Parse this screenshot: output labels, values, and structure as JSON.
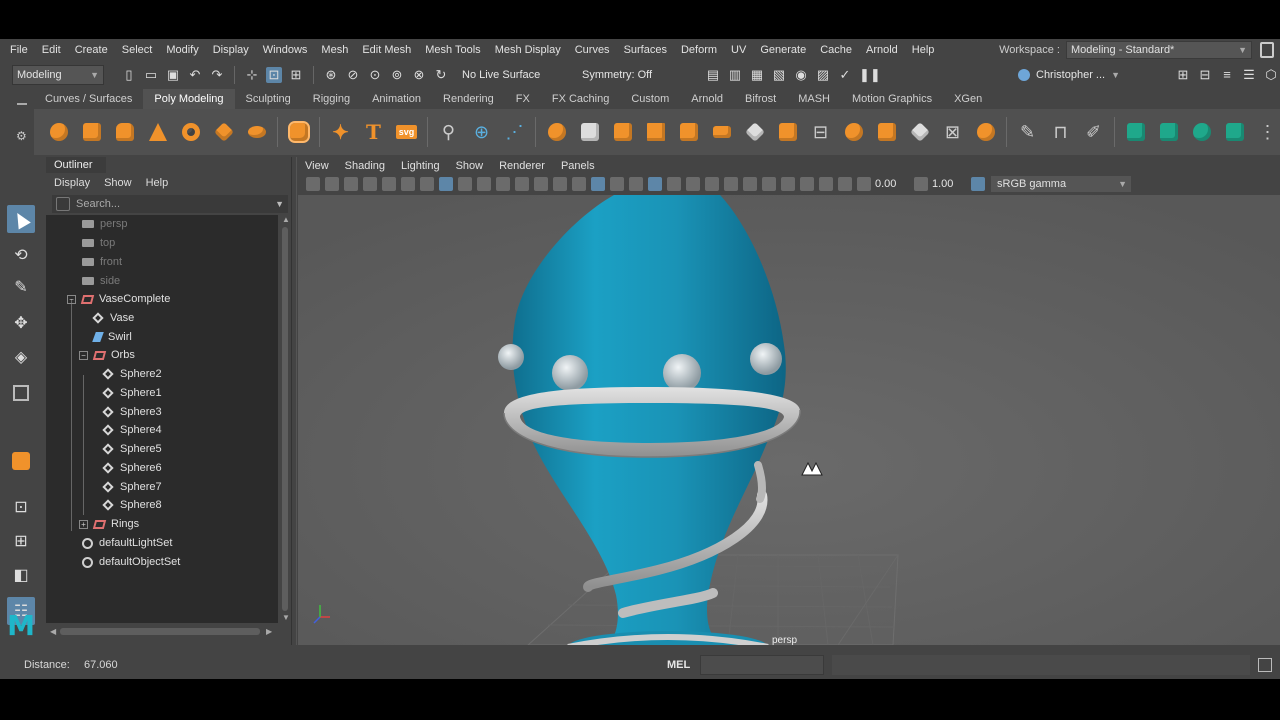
{
  "menubar": {
    "items": [
      "File",
      "Edit",
      "Create",
      "Select",
      "Modify",
      "Display",
      "Windows",
      "Mesh",
      "Edit Mesh",
      "Mesh Tools",
      "Mesh Display",
      "Curves",
      "Surfaces",
      "Deform",
      "UV",
      "Generate",
      "Cache",
      "Arnold",
      "Help"
    ],
    "workspace_label": "Workspace :",
    "workspace_value": "Modeling - Standard*"
  },
  "statusline": {
    "mode": "Modeling",
    "live_surface": "No Live Surface",
    "symmetry": "Symmetry: Off",
    "user": "Christopher ..."
  },
  "shelf": {
    "tabs": [
      "Curves / Surfaces",
      "Poly Modeling",
      "Sculpting",
      "Rigging",
      "Animation",
      "Rendering",
      "FX",
      "FX Caching",
      "Custom",
      "Arnold",
      "Bifrost",
      "MASH",
      "Motion Graphics",
      "XGen"
    ],
    "active_tab": "Poly Modeling",
    "text_icons": {
      "type": "T",
      "svg": "svg"
    }
  },
  "outliner": {
    "title": "Outliner",
    "menu": [
      "Display",
      "Show",
      "Help"
    ],
    "search_placeholder": "Search...",
    "items": [
      {
        "label": "persp",
        "icon": "camera-icon",
        "dim": true
      },
      {
        "label": "top",
        "icon": "camera-icon",
        "dim": true
      },
      {
        "label": "front",
        "icon": "camera-icon",
        "dim": true
      },
      {
        "label": "side",
        "icon": "camera-icon",
        "dim": true
      },
      {
        "label": "VaseComplete",
        "icon": "group-icon"
      },
      {
        "label": "Vase",
        "icon": "mesh-icon"
      },
      {
        "label": "Swirl",
        "icon": "curve-icon"
      },
      {
        "label": "Orbs",
        "icon": "group-icon"
      },
      {
        "label": "Sphere2",
        "icon": "mesh-icon"
      },
      {
        "label": "Sphere1",
        "icon": "mesh-icon"
      },
      {
        "label": "Sphere3",
        "icon": "mesh-icon"
      },
      {
        "label": "Sphere4",
        "icon": "mesh-icon"
      },
      {
        "label": "Sphere5",
        "icon": "mesh-icon"
      },
      {
        "label": "Sphere6",
        "icon": "mesh-icon"
      },
      {
        "label": "Sphere7",
        "icon": "mesh-icon"
      },
      {
        "label": "Sphere8",
        "icon": "mesh-icon"
      },
      {
        "label": "Rings",
        "icon": "group-icon"
      },
      {
        "label": "defaultLightSet",
        "icon": "set-icon"
      },
      {
        "label": "defaultObjectSet",
        "icon": "set-icon"
      }
    ]
  },
  "viewport": {
    "menu": [
      "View",
      "Shading",
      "Lighting",
      "Show",
      "Renderer",
      "Panels"
    ],
    "value_a": "0.00",
    "value_b": "1.00",
    "color_space": "sRGB gamma",
    "camera": "persp"
  },
  "bottombar": {
    "distance_label": "Distance:",
    "distance_value": "67.060",
    "mel_label": "MEL"
  },
  "colors": {
    "vase": "#1b8fb1",
    "ring": "#b8b8b8",
    "orb": "#c4cacc",
    "accent": "#5d86a8",
    "poly_orange": "#f0922b",
    "maya_logo": "#1fb6c9"
  }
}
